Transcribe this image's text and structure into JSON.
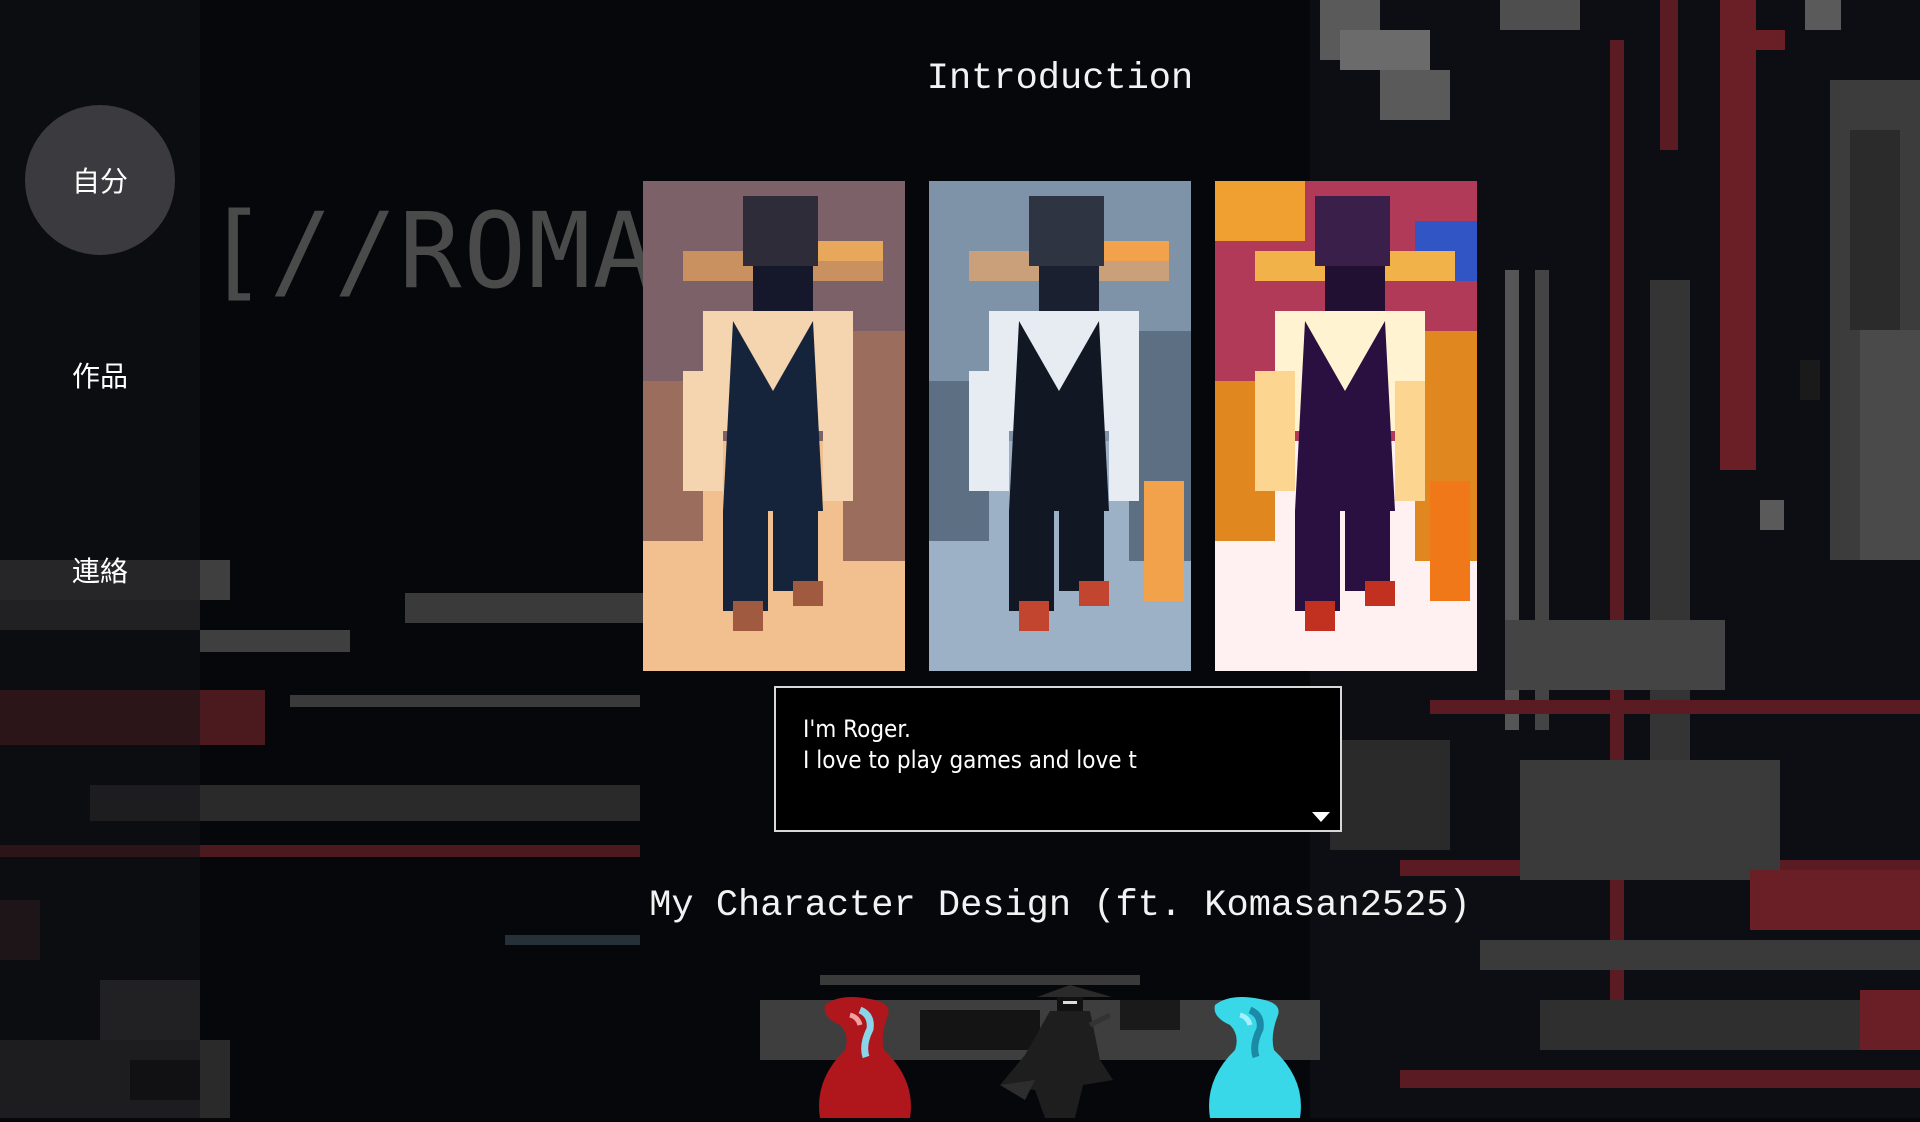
{
  "sidebar": {
    "items": [
      {
        "label": "自分",
        "active": true
      },
      {
        "label": "作品",
        "active": false
      },
      {
        "label": "連絡",
        "active": false
      }
    ]
  },
  "background": {
    "logo_text": "[//ROMAR"
  },
  "intro": {
    "title": "Introduction",
    "portraits": [
      {
        "palette": "warm-sepia"
      },
      {
        "palette": "cool-blue-gray"
      },
      {
        "palette": "vivid-orange-purple"
      }
    ]
  },
  "dialog": {
    "text": "I'm Roger.\nI love to play games and love t",
    "continue_icon": "triangle-down-icon"
  },
  "character_design": {
    "title": "My Character Design (ft. Komasan2525)",
    "sprites": [
      "red-vase-character",
      "ninja-character",
      "cyan-vase-character"
    ]
  },
  "colors": {
    "background": "#06070b",
    "sidebar_active": "#3b3b3f",
    "accent_red": "#7a1f24",
    "dialog_border": "#d8d8d8"
  }
}
